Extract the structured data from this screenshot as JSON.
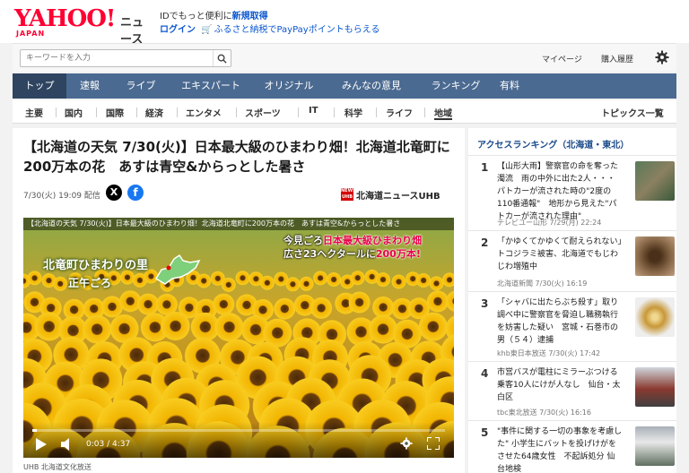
{
  "header": {
    "logo_text": "YAHOO!",
    "logo_sub": "JAPAN",
    "service": "ニュース",
    "line1_prefix": "IDでもっと便利に",
    "line1_link": "新規取得",
    "login": "ログイン",
    "promo": "ふるさと納税でPayPayポイントもらえる"
  },
  "search": {
    "placeholder": "キーワードを入力",
    "mypage": "マイページ",
    "history": "購入履歴"
  },
  "nav": [
    "トップ",
    "速報",
    "ライブ",
    "エキスパート",
    "オリジナル",
    "みんなの意見",
    "ランキング",
    "有料"
  ],
  "subnav": [
    "主要",
    "国内",
    "国際",
    "経済",
    "エンタメ",
    "スポーツ",
    "IT",
    "科学",
    "ライフ",
    "地域"
  ],
  "subnav_right": "トピックス一覧",
  "article": {
    "title": "【北海道の天気 7/30(火)】日本最大級のひまわり畑！北海道北竜町に200万本の花　あすは青空&からっとした暑さ",
    "meta": "7/30(火) 19:09 配信",
    "source": "北海道ニュースUHB",
    "source_mark": "NEWS UHB",
    "video_title": "【北海道の天気 7/30(火)】日本最大級のひまわり畑！北海道北竜町に200万本の花　あすは青空&からっとした暑さ",
    "caption1_a": "今見ごろ",
    "caption1_b": "日本最大級ひまわり畑",
    "caption2_a": "広さ23ヘクタールに",
    "caption2_b": "200万本!",
    "place": "北竜町ひまわりの里",
    "time_of_day": "正午ごろ",
    "timer": "0:03 / 4:37",
    "progress": 0.011,
    "credit": "UHB 北海道文化放送"
  },
  "ranking": {
    "title": "アクセスランキング（北海道・東北）",
    "items": [
      {
        "num": "1",
        "text": "【山形大雨】警察官の命を奪った濁流　雨の中外に出た2人・・・パトカーが流された時の\"2度の110番通報\"　地形から見えた\"パトカーが流された理由\"",
        "src": "テレビユー山形 7/29(月) 22:24"
      },
      {
        "num": "2",
        "text": "「かゆくてかゆくて耐えられない」トコジラミ被害、北海道でもじわじわ増殖中",
        "src": "北海道新聞 7/30(火) 16:19"
      },
      {
        "num": "3",
        "text": "「シャバに出たらぶち殺す」取り調べ中に警察官を脅迫し職務執行を妨害した疑い　宮城・石巻市の男（５４）逮捕",
        "src": "khb東日本放送 7/30(火) 17:42"
      },
      {
        "num": "4",
        "text": "市営バスが電柱にミラーぶつける 乗客10人にけが人なし　仙台・太白区",
        "src": "tbc東北放送 7/30(火) 16:16"
      },
      {
        "num": "5",
        "text": "\"事件に関する一切の事象を考慮した\" 小学生にバットを投げけがをさせた64歳女性　不起訴処分 仙台地検",
        "src": ""
      }
    ]
  }
}
